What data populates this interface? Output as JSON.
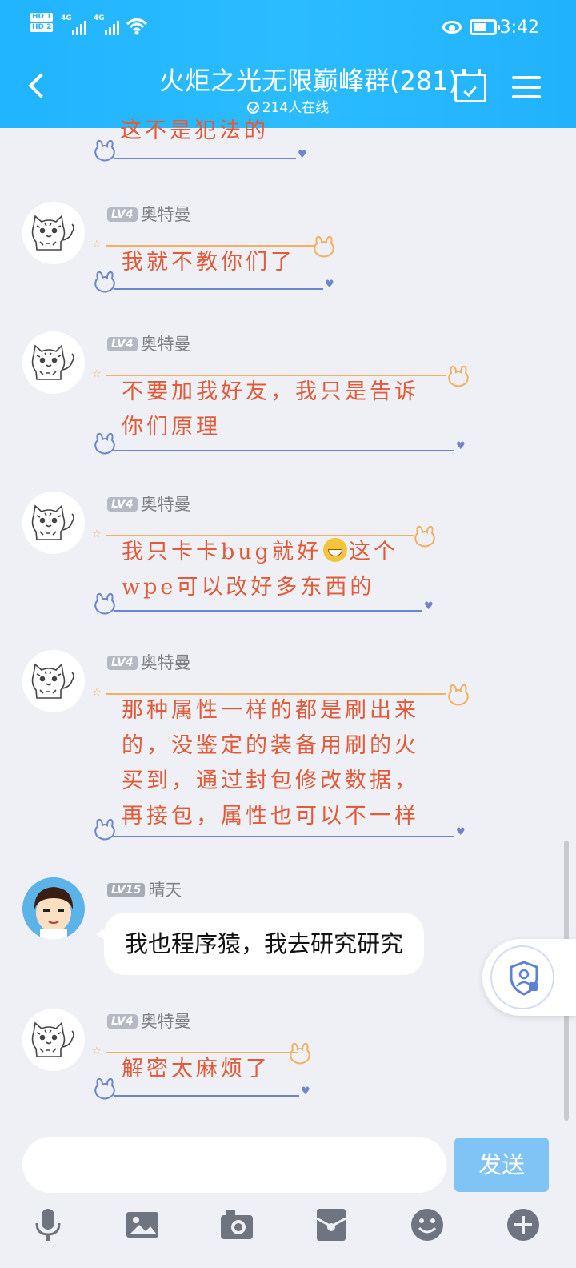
{
  "status": {
    "sim1": "HD 1",
    "sim2": "HD 2",
    "net1": "4G",
    "net2": "4G",
    "time": "3:42"
  },
  "header": {
    "title": "火炬之光无限巅峰群(281)",
    "online": "214人在线"
  },
  "messages": [
    {
      "kind": "deco",
      "level": "",
      "name": "",
      "lines": [
        "这不是犯法的"
      ]
    },
    {
      "kind": "deco",
      "level": "LV4",
      "name": "奥特曼",
      "lines": [
        "我就不教你们了"
      ]
    },
    {
      "kind": "deco",
      "level": "LV4",
      "name": "奥特曼",
      "lines": [
        "不要加我好友，我只是告诉",
        "你们原理"
      ]
    },
    {
      "kind": "deco",
      "level": "LV4",
      "name": "奥特曼",
      "lines": [
        "我只卡卡bug就好",
        "这个",
        "wpe可以改好多东西的"
      ]
    },
    {
      "kind": "deco",
      "level": "LV4",
      "name": "奥特曼",
      "lines": [
        "那种属性一样的都是刷出来",
        "的，没鉴定的装备用刷的火",
        "买到，通过封包修改数据，",
        "再接包，属性也可以不一样"
      ]
    },
    {
      "kind": "normal",
      "level": "LV15",
      "name": "晴天",
      "text": "我也程序猿，我去研究研究"
    },
    {
      "kind": "deco",
      "level": "LV4",
      "name": "奥特曼",
      "lines": [
        "解密太麻烦了"
      ]
    }
  ],
  "input": {
    "placeholder": "",
    "send_label": "发送"
  },
  "toolbar": [
    "voice-icon",
    "image-icon",
    "camera-icon",
    "red-packet-icon",
    "emoji-icon",
    "plus-icon"
  ],
  "colors": {
    "header": "#2bb8fe",
    "deco_text": "#e35a38",
    "deco_top": "#f5b05e",
    "deco_bottom": "#6c86c9",
    "send": "#7fc4f4"
  }
}
